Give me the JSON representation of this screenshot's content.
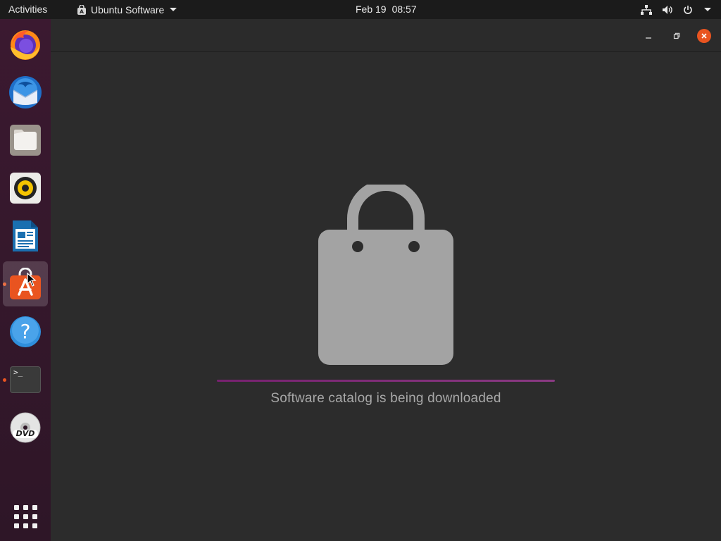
{
  "topbar": {
    "activities": "Activities",
    "app_name": "Ubuntu Software",
    "date": "Feb 19",
    "time": "08:57"
  },
  "dock": {
    "items": [
      {
        "name": "firefox",
        "icon": "firefox-icon",
        "running": false,
        "active": false
      },
      {
        "name": "thunderbird",
        "icon": "thunderbird-icon",
        "running": false,
        "active": false
      },
      {
        "name": "files",
        "icon": "files-icon",
        "running": false,
        "active": false
      },
      {
        "name": "rhythmbox",
        "icon": "rhythmbox-icon",
        "running": false,
        "active": false
      },
      {
        "name": "libreoffice-writer",
        "icon": "writer-icon",
        "running": false,
        "active": false
      },
      {
        "name": "ubuntu-software",
        "icon": "software-icon",
        "running": true,
        "active": true
      },
      {
        "name": "help",
        "icon": "help-icon",
        "running": false,
        "active": false
      },
      {
        "name": "terminal",
        "icon": "terminal-icon",
        "running": true,
        "active": false
      },
      {
        "name": "dvd",
        "icon": "dvd-icon",
        "running": false,
        "active": false
      }
    ],
    "show_apps_icon": "app-grid-icon",
    "terminal_prompt": ">_",
    "dvd_label": "DVD"
  },
  "window": {
    "status_message": "Software catalog is being downloaded",
    "progress": 1.0,
    "colors": {
      "accent": "#e95420",
      "progress": "#77216f",
      "bag": "#a3a3a3"
    }
  }
}
